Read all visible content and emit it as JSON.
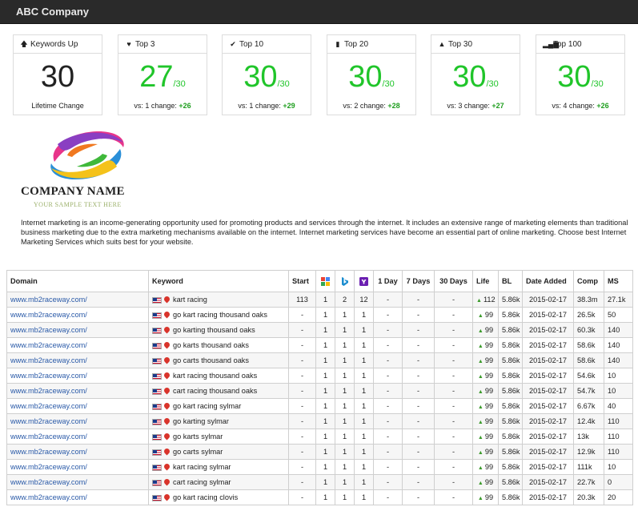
{
  "app": {
    "title": "ABC Company"
  },
  "colors": {
    "accent_green": "#20c52a",
    "link_blue": "#2a5aa8",
    "topbar": "#2a2a2a"
  },
  "stats": [
    {
      "icon": "arrow-up-icon",
      "glyph": "🡅",
      "label": "Keywords Up",
      "value": "30",
      "denominator": "",
      "footer_text": "Lifetime Change",
      "change": ""
    },
    {
      "icon": "heart-icon",
      "glyph": "♥",
      "label": "Top 3",
      "value": "27",
      "denominator": "/30",
      "footer_text": "vs: 1 change:",
      "change": "+26"
    },
    {
      "icon": "check-icon",
      "glyph": "✔",
      "label": "Top 10",
      "value": "30",
      "denominator": "/30",
      "footer_text": "vs: 1 change:",
      "change": "+29"
    },
    {
      "icon": "bookmark-icon",
      "glyph": "▮",
      "label": "Top 20",
      "value": "30",
      "denominator": "/30",
      "footer_text": "vs: 2 change:",
      "change": "+28"
    },
    {
      "icon": "road-icon",
      "glyph": "▲",
      "label": "Top 30",
      "value": "30",
      "denominator": "/30",
      "footer_text": "vs: 3 change:",
      "change": "+27"
    },
    {
      "icon": "signal-bars-icon",
      "glyph": "▂▄▆",
      "label": "Top 100",
      "value": "30",
      "denominator": "/30",
      "footer_text": "vs: 4 change:",
      "change": "+26"
    }
  ],
  "logo": {
    "company_name": "COMPANY NAME",
    "tagline": "YOUR SAMPLE TEXT HERE"
  },
  "intro": "Internet marketing is an income-generating opportunity used for promoting products and services through the internet. It includes an extensive range of marketing elements than traditional business marketing due to the extra marketing mechanisms available on the internet. Internet marketing services have become an essential part of online marketing. Choose best Internet Marketing Services which suits best for your website.",
  "table": {
    "headers": {
      "domain": "Domain",
      "keyword": "Keyword",
      "start": "Start",
      "google": "google-icon",
      "bing": "bing-icon",
      "yahoo": "yahoo-icon",
      "day1": "1 Day",
      "days7": "7 Days",
      "days30": "30 Days",
      "life": "Life",
      "bl": "BL",
      "date_added": "Date Added",
      "comp": "Comp",
      "ms": "MS"
    },
    "rows": [
      {
        "domain": "www.mb2raceway.com/",
        "keyword": "kart racing",
        "start": "113",
        "g": "1",
        "b": "2",
        "y": "12",
        "d1": "-",
        "d7": "-",
        "d30": "-",
        "life": "112",
        "bl": "5.86k",
        "date": "2015-02-17",
        "comp": "38.3m",
        "ms": "27.1k"
      },
      {
        "domain": "www.mb2raceway.com/",
        "keyword": "go kart racing thousand oaks",
        "start": "-",
        "g": "1",
        "b": "1",
        "y": "1",
        "d1": "-",
        "d7": "-",
        "d30": "-",
        "life": "99",
        "bl": "5.86k",
        "date": "2015-02-17",
        "comp": "26.5k",
        "ms": "50"
      },
      {
        "domain": "www.mb2raceway.com/",
        "keyword": "go karting thousand oaks",
        "start": "-",
        "g": "1",
        "b": "1",
        "y": "1",
        "d1": "-",
        "d7": "-",
        "d30": "-",
        "life": "99",
        "bl": "5.86k",
        "date": "2015-02-17",
        "comp": "60.3k",
        "ms": "140"
      },
      {
        "domain": "www.mb2raceway.com/",
        "keyword": "go karts thousand oaks",
        "start": "-",
        "g": "1",
        "b": "1",
        "y": "1",
        "d1": "-",
        "d7": "-",
        "d30": "-",
        "life": "99",
        "bl": "5.86k",
        "date": "2015-02-17",
        "comp": "58.6k",
        "ms": "140"
      },
      {
        "domain": "www.mb2raceway.com/",
        "keyword": "go carts thousand oaks",
        "start": "-",
        "g": "1",
        "b": "1",
        "y": "1",
        "d1": "-",
        "d7": "-",
        "d30": "-",
        "life": "99",
        "bl": "5.86k",
        "date": "2015-02-17",
        "comp": "58.6k",
        "ms": "140"
      },
      {
        "domain": "www.mb2raceway.com/",
        "keyword": "kart racing thousand oaks",
        "start": "-",
        "g": "1",
        "b": "1",
        "y": "1",
        "d1": "-",
        "d7": "-",
        "d30": "-",
        "life": "99",
        "bl": "5.86k",
        "date": "2015-02-17",
        "comp": "54.6k",
        "ms": "10"
      },
      {
        "domain": "www.mb2raceway.com/",
        "keyword": "cart racing thousand oaks",
        "start": "-",
        "g": "1",
        "b": "1",
        "y": "1",
        "d1": "-",
        "d7": "-",
        "d30": "-",
        "life": "99",
        "bl": "5.86k",
        "date": "2015-02-17",
        "comp": "54.7k",
        "ms": "10"
      },
      {
        "domain": "www.mb2raceway.com/",
        "keyword": "go kart racing sylmar",
        "start": "-",
        "g": "1",
        "b": "1",
        "y": "1",
        "d1": "-",
        "d7": "-",
        "d30": "-",
        "life": "99",
        "bl": "5.86k",
        "date": "2015-02-17",
        "comp": "6.67k",
        "ms": "40"
      },
      {
        "domain": "www.mb2raceway.com/",
        "keyword": "go karting sylmar",
        "start": "-",
        "g": "1",
        "b": "1",
        "y": "1",
        "d1": "-",
        "d7": "-",
        "d30": "-",
        "life": "99",
        "bl": "5.86k",
        "date": "2015-02-17",
        "comp": "12.4k",
        "ms": "110"
      },
      {
        "domain": "www.mb2raceway.com/",
        "keyword": "go karts sylmar",
        "start": "-",
        "g": "1",
        "b": "1",
        "y": "1",
        "d1": "-",
        "d7": "-",
        "d30": "-",
        "life": "99",
        "bl": "5.86k",
        "date": "2015-02-17",
        "comp": "13k",
        "ms": "110"
      },
      {
        "domain": "www.mb2raceway.com/",
        "keyword": "go carts sylmar",
        "start": "-",
        "g": "1",
        "b": "1",
        "y": "1",
        "d1": "-",
        "d7": "-",
        "d30": "-",
        "life": "99",
        "bl": "5.86k",
        "date": "2015-02-17",
        "comp": "12.9k",
        "ms": "110"
      },
      {
        "domain": "www.mb2raceway.com/",
        "keyword": "kart racing sylmar",
        "start": "-",
        "g": "1",
        "b": "1",
        "y": "1",
        "d1": "-",
        "d7": "-",
        "d30": "-",
        "life": "99",
        "bl": "5.86k",
        "date": "2015-02-17",
        "comp": "111k",
        "ms": "10"
      },
      {
        "domain": "www.mb2raceway.com/",
        "keyword": "cart racing sylmar",
        "start": "-",
        "g": "1",
        "b": "1",
        "y": "1",
        "d1": "-",
        "d7": "-",
        "d30": "-",
        "life": "99",
        "bl": "5.86k",
        "date": "2015-02-17",
        "comp": "22.7k",
        "ms": "0"
      },
      {
        "domain": "www.mb2raceway.com/",
        "keyword": "go kart racing clovis",
        "start": "-",
        "g": "1",
        "b": "1",
        "y": "1",
        "d1": "-",
        "d7": "-",
        "d30": "-",
        "life": "99",
        "bl": "5.86k",
        "date": "2015-02-17",
        "comp": "20.3k",
        "ms": "20"
      }
    ]
  }
}
